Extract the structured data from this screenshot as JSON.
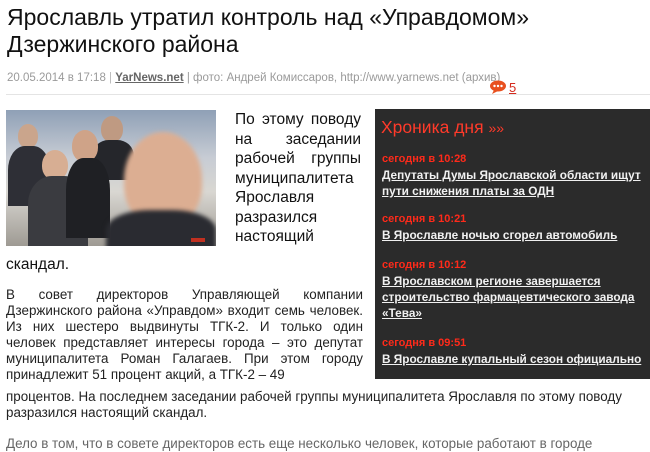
{
  "article": {
    "title": "Ярославль утратил контроль над «Управдомом» Дзержинского района",
    "date": "20.05.2014 в 17:18",
    "separator": "|",
    "source": "YarNews.net",
    "photo_credit": "| фото: Андрей Комиссаров, http://www.yarnews.net (архив)",
    "comments_count": "5",
    "lead_text": "По этому поводу на заседании рабочей группы муниципалитета Ярославля разразился настоящий",
    "lead_end": "скандал.",
    "paragraph1": "В совет директоров Управляющей компании Дзержинского района «Управдом» входит семь человек. Из них шестеро выдвинуты ТГК-2. И только один человек представляет интересы города – это депутат муниципалитета Роман Галагаев. При этом городу принадлежит 51 процент акций, а ТГК-2 – 49",
    "paragraph1_tail": "процентов. На последнем заседании рабочей группы муниципалитета Ярославля по этому поводу",
    "paragraph1_tail2": "разразился настоящий скандал.",
    "paragraph2_partial": "Дело в том, что в совете директоров есть еще несколько человек, которые работают в городе"
  },
  "chronicle": {
    "title": "Хроника дня",
    "arrow": "»»",
    "items": [
      {
        "time": "сегодня в 10:28",
        "text": "Депутаты Думы Ярославской области ищут пути снижения платы за ОДН"
      },
      {
        "time": "сегодня в 10:21",
        "text": "В Ярославле ночью сгорел автомобиль"
      },
      {
        "time": "сегодня в 10:12",
        "text": "В Ярославском регионе завершается строительство фармацевтического завода «Тева»"
      },
      {
        "time": "сегодня в 09:51",
        "text": "В Ярославле купальный сезон официально"
      }
    ]
  },
  "colors": {
    "accent": "#ff3a2a",
    "sidebar_bg": "#2b2b2b",
    "comment_icon": "#d52b1e"
  },
  "icons": {
    "comments": "speech-bubble-icon"
  }
}
